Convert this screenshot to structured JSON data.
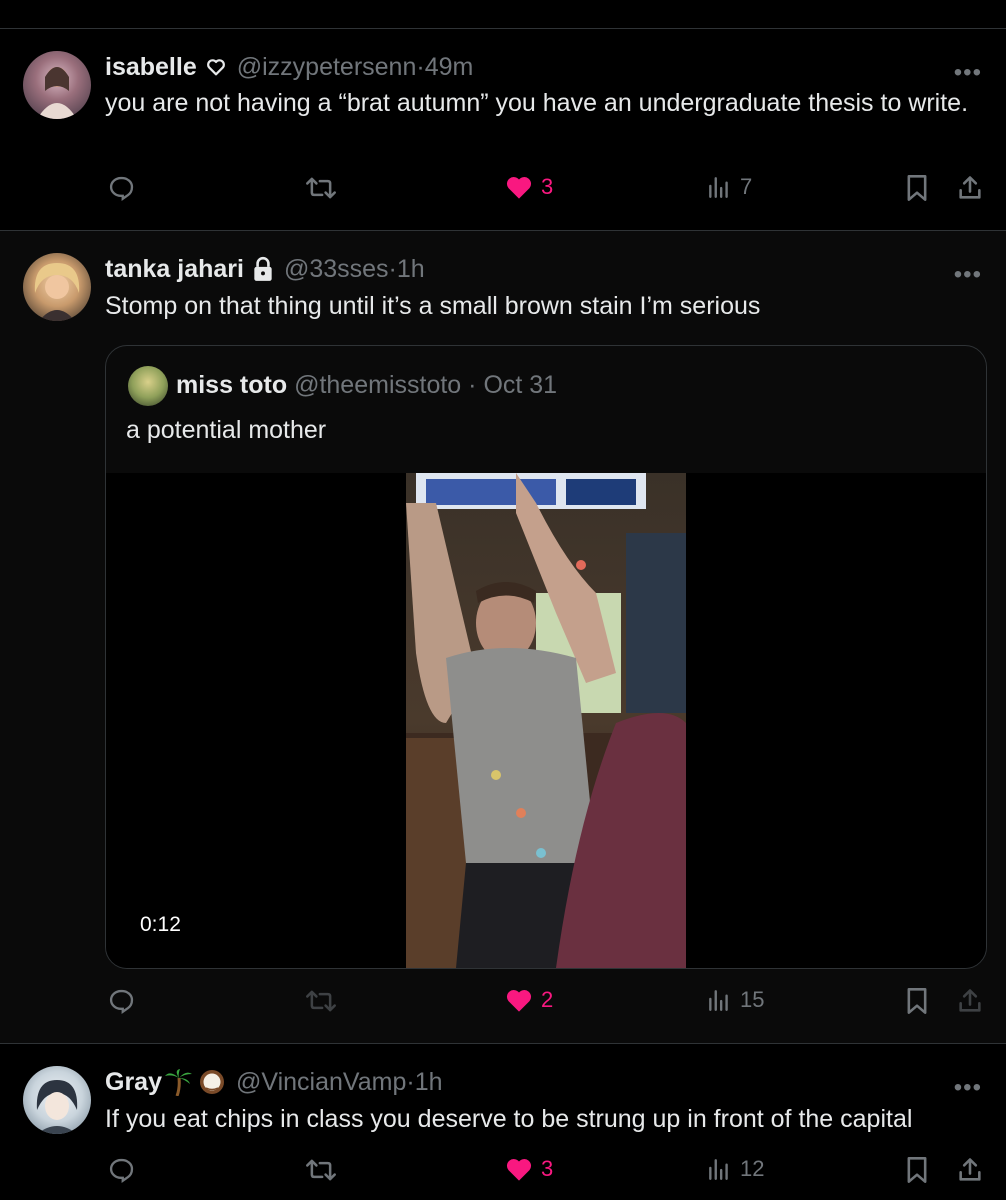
{
  "tweets": [
    {
      "name": "isabelle",
      "handle": "@izzypetersenn",
      "time": "49m",
      "text": "you are not having a “brat autumn” you have an undergraduate thesis to write.",
      "likes": "3",
      "views": "7"
    },
    {
      "name": "tanka jahari",
      "handle": "@33sses",
      "time": "1h",
      "text": "Stomp on that thing until it’s a small brown stain I’m serious",
      "quote": {
        "name": "miss toto",
        "handle": "@theemisstoto",
        "time": "Oct 31",
        "text": "a potential mother",
        "duration": "0:12"
      },
      "likes": "2",
      "views": "15"
    },
    {
      "name": "Gray",
      "handle": "@VincianVamp",
      "time": "1h",
      "text": "If you eat chips in class you deserve to be strung up in front of the capital",
      "likes": "3",
      "views": "12"
    }
  ],
  "separator": " · ",
  "more": "•••",
  "colors": {
    "like": "#f91880",
    "muted": "#71767b",
    "text": "#e7e9ea",
    "divider": "#2f3336"
  }
}
